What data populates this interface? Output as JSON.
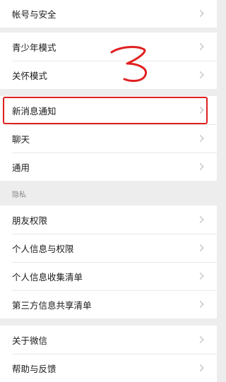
{
  "groups": [
    {
      "items": [
        {
          "label": "帐号与安全"
        }
      ]
    },
    {
      "items": [
        {
          "label": "青少年模式"
        },
        {
          "label": "关怀模式"
        }
      ]
    },
    {
      "items": [
        {
          "label": "新消息通知"
        },
        {
          "label": "聊天"
        },
        {
          "label": "通用"
        }
      ]
    },
    {
      "header": "隐私",
      "items": [
        {
          "label": "朋友权限"
        },
        {
          "label": "个人信息与权限"
        },
        {
          "label": "个人信息收集清单"
        },
        {
          "label": "第三方信息共享清单"
        }
      ]
    },
    {
      "items": [
        {
          "label": "关于微信"
        },
        {
          "label": "帮助与反馈"
        }
      ]
    }
  ],
  "annotation": {
    "text": "3",
    "color": "#e02020"
  },
  "colors": {
    "background": "#ededed",
    "card": "#ffffff",
    "highlight": "#e02020"
  }
}
